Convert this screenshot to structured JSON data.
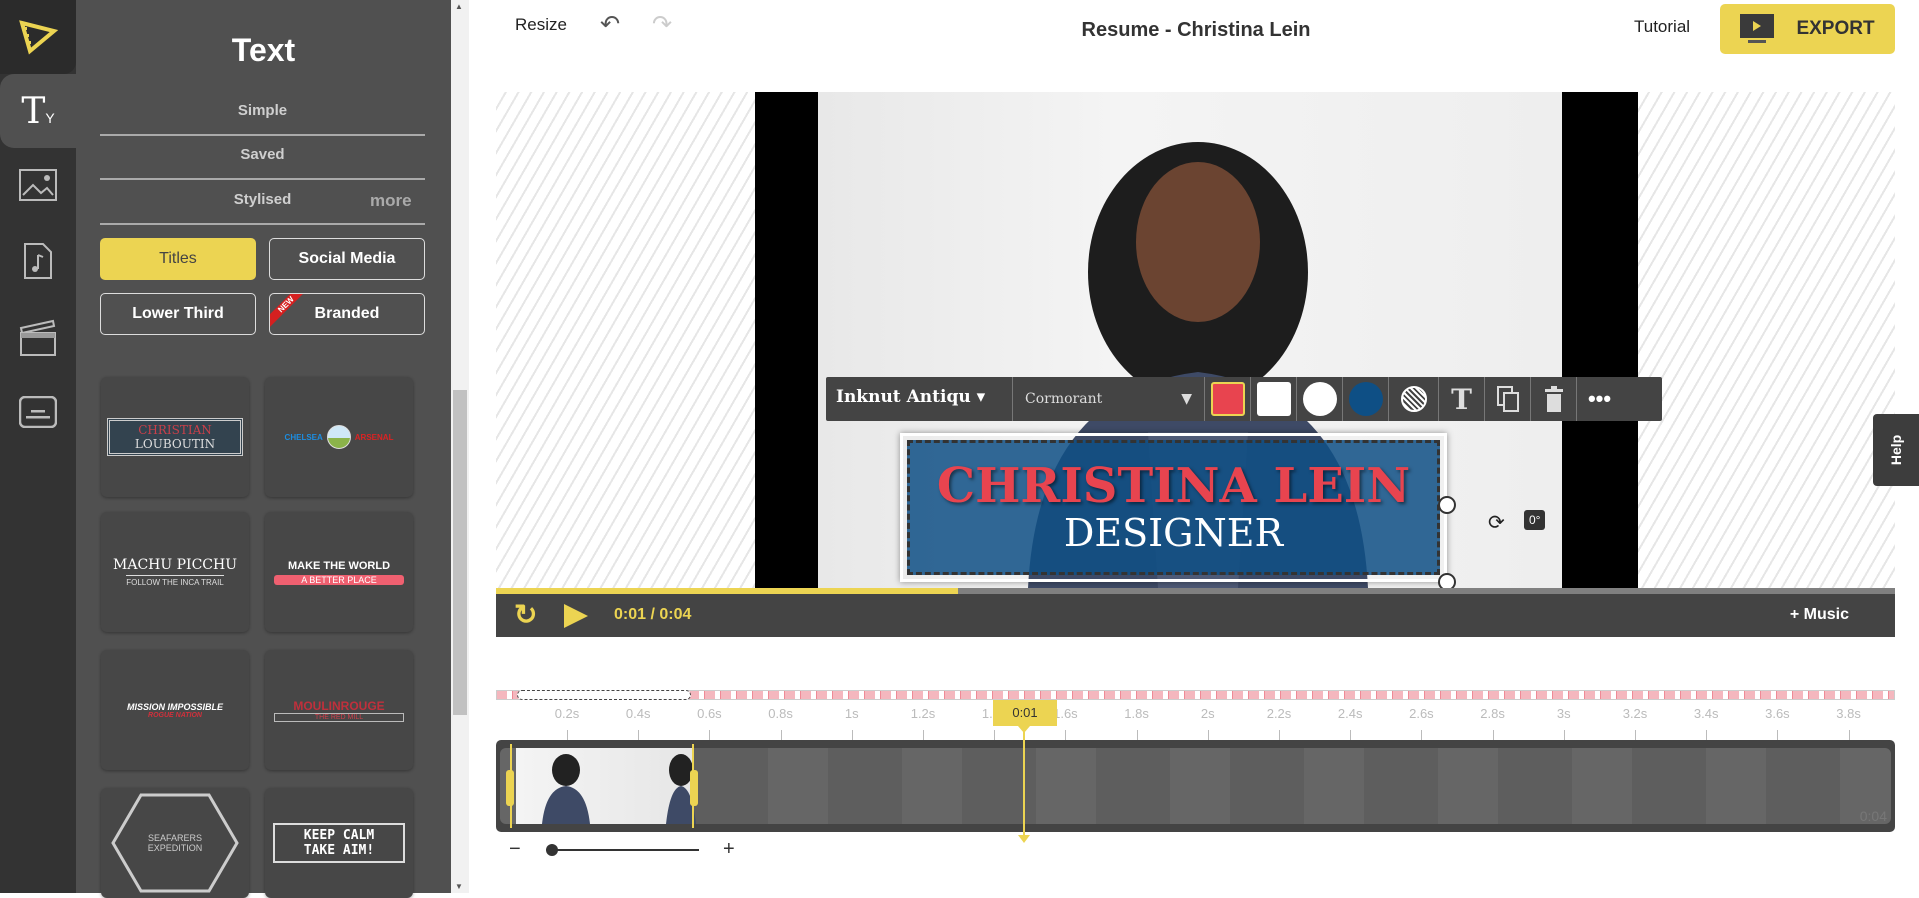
{
  "sidebar": {
    "items": [
      {
        "name": "logo"
      },
      {
        "name": "text",
        "active": true
      },
      {
        "name": "images"
      },
      {
        "name": "music"
      },
      {
        "name": "scenes"
      },
      {
        "name": "subtitles"
      }
    ]
  },
  "panel": {
    "title": "Text",
    "tabs": [
      "Simple",
      "Saved",
      "Stylised"
    ],
    "more": "more",
    "categories": [
      {
        "label": "Titles",
        "active": true
      },
      {
        "label": "Social Media"
      },
      {
        "label": "Lower Third"
      },
      {
        "label": "Branded",
        "badge": "NEW"
      }
    ],
    "templates": [
      {
        "line1": "CHRISTIAN",
        "line2": "LOUBOUTIN"
      },
      {
        "line1": "CHELSEA",
        "line2": "ARSENAL"
      },
      {
        "line1": "MACHU PICCHU",
        "line2": "FOLLOW THE INCA TRAIL"
      },
      {
        "line1": "MAKE THE WORLD",
        "line2": "A BETTER PLACE"
      },
      {
        "line1": "MISSION IMPOSSIBLE",
        "line2": "ROGUE NATION"
      },
      {
        "line1": "MOULINROUGE",
        "line2": "THE RED MILL"
      },
      {
        "line1": "SEAFARERS",
        "line2": "EXPEDITION"
      },
      {
        "line1": "KEEP CALM",
        "line2": "TAKE AIM!"
      }
    ]
  },
  "header": {
    "resize": "Resize",
    "title": "Resume - Christina Lein",
    "tutorial": "Tutorial",
    "export": "EXPORT"
  },
  "toolbar": {
    "font1": "Inknut Antiqu",
    "font2": "Cormorant",
    "colors": [
      "#e8444f",
      "#ffffff",
      "#ffffff",
      "#0e4f85"
    ]
  },
  "overlay": {
    "title": "CHRISTINA LEIN",
    "subtitle": "DESIGNER",
    "rotation": "0°"
  },
  "player": {
    "time": "0:01 / 0:04",
    "progress": 0.33,
    "music": "+ Music"
  },
  "timeline": {
    "labels": [
      "0.2s",
      "0.4s",
      "0.6s",
      "0.8s",
      "1s",
      "1.2s",
      "1.4s",
      "1.6s",
      "1.8s",
      "2s",
      "2.2s",
      "2.4s",
      "2.6s",
      "2.8s",
      "3s",
      "3.2s",
      "3.4s",
      "3.6s",
      "3.8s"
    ],
    "playhead": "0:01",
    "end": "0:04",
    "zoom_minus": "−",
    "zoom_plus": "+"
  },
  "help": "Help",
  "colors": {
    "accent": "#ecd452",
    "panel": "#505050",
    "dark": "#444444"
  }
}
